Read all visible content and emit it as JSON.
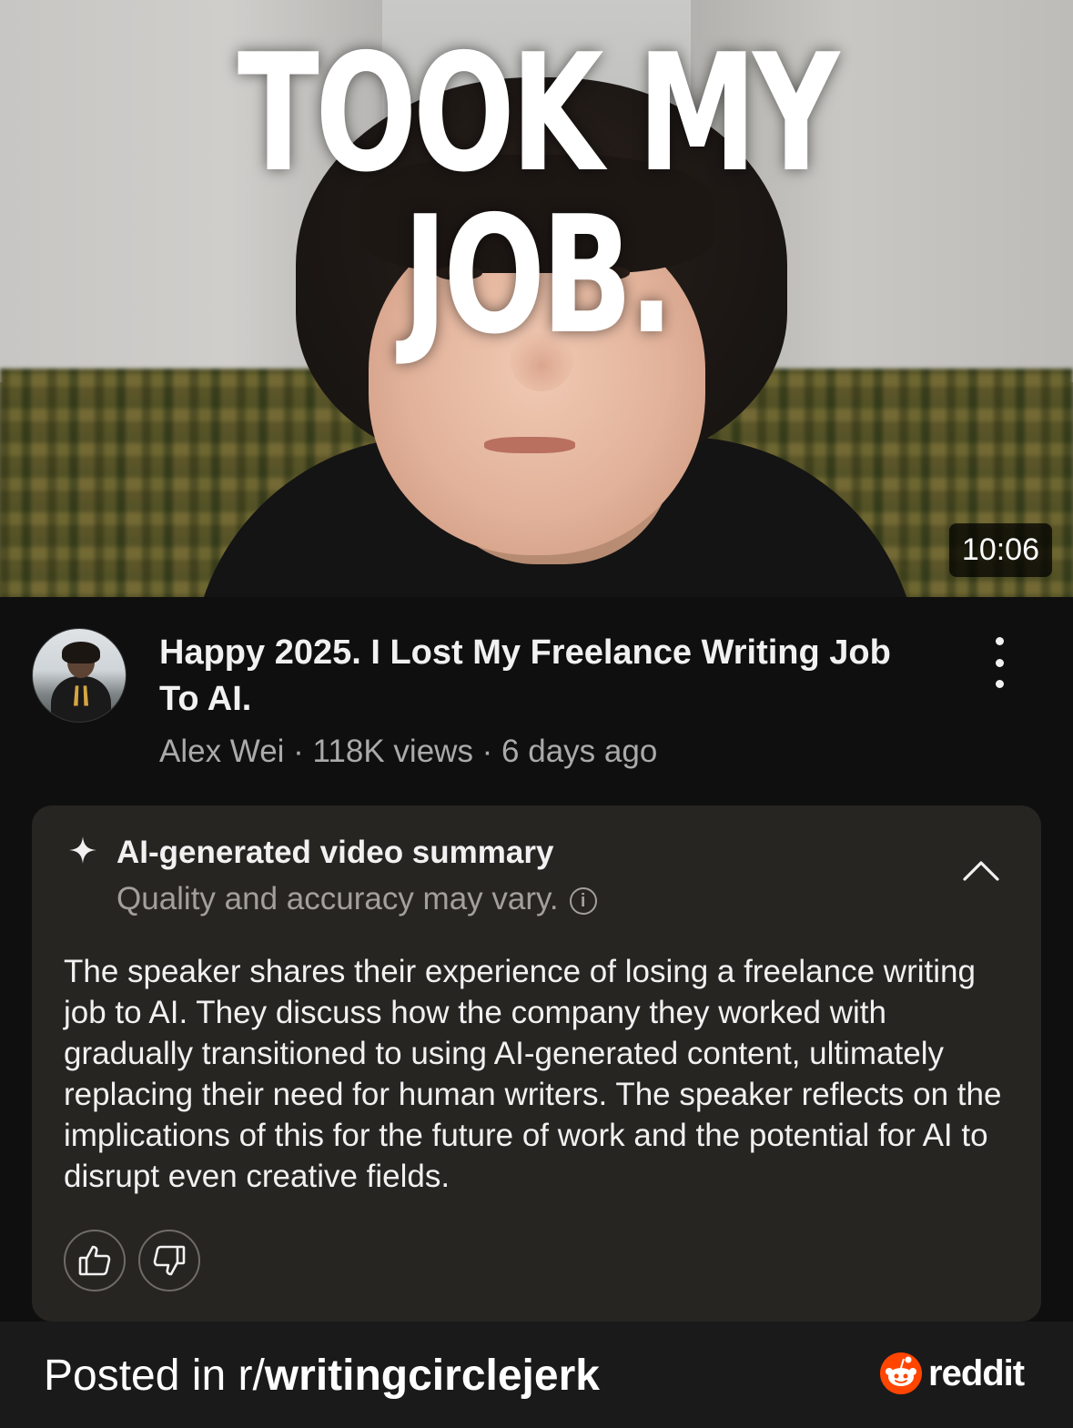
{
  "thumbnail": {
    "overlay_text": "TOOK MY JOB.",
    "duration": "10:06"
  },
  "video": {
    "title": "Happy 2025. I Lost My Freelance Writing Job To AI.",
    "meta": "Alex Wei · 118K views · 6 days ago",
    "channel": "Alex Wei",
    "views": "118K views",
    "age": "6 days ago"
  },
  "summary": {
    "heading": "AI-generated video summary",
    "disclaimer": "Quality and accuracy may vary.",
    "body": "The speaker shares their experience of losing a freelance writing job to AI. They discuss how the company they worked with gradually transitioned to using AI-generated content, ultimately replacing their need for human writers. The speaker reflects on the implications of this for the future of work and the potential for AI to disrupt even creative fields."
  },
  "icons": {
    "sparkle": "sparkle-icon",
    "info": "info-icon",
    "collapse": "chevron-up-icon",
    "like": "thumbs-up-icon",
    "dislike": "thumbs-down-icon",
    "more": "more-vertical-icon"
  },
  "footer": {
    "prefix": "Posted in r/",
    "subreddit": "writingcirclejerk",
    "brand": "reddit"
  },
  "colors": {
    "background": "#0f0f0f",
    "card": "#272522",
    "footer": "#1a1a1b",
    "reddit_orange": "#ff4500"
  }
}
